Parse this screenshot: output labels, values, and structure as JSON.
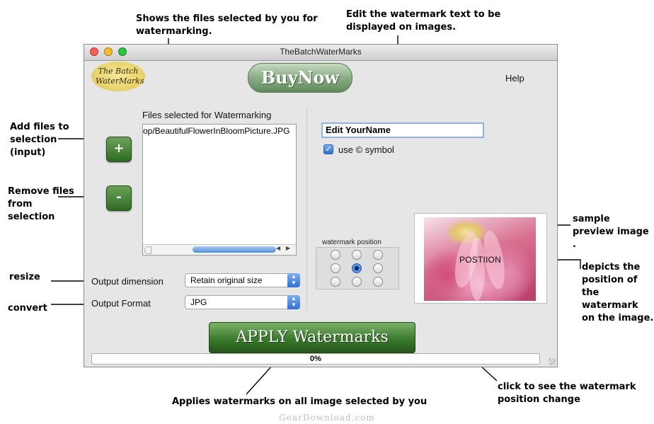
{
  "callouts": {
    "files_selected": "Shows the files selected by you for watermarking.",
    "edit_text": "Edit the watermark text to be displayed on images.",
    "add_files": "Add files to selection (input)",
    "remove_files": "Remove files from selection",
    "resize": "resize",
    "convert": "convert",
    "sample_preview": "sample preview image .",
    "depicts_position": "depicts the position of the watermark on the image.",
    "click_to_see": "click to see the watermark position change",
    "applies_watermarks": "Applies watermarks on all image selected by you"
  },
  "window": {
    "title": "TheBatchWaterMarks",
    "traffic_colors": [
      "#ff5f57",
      "#febc2e",
      "#28c840"
    ]
  },
  "header": {
    "logo_text": "The Batch WaterMarks",
    "buy_now_label": "BuyNow",
    "help_label": "Help"
  },
  "files": {
    "heading": "Files selected for Watermarking",
    "items": [
      "op/BeautifulFlowerInBloomPicture.JPG"
    ],
    "add_label": "+",
    "remove_label": "-"
  },
  "output": {
    "dimension_label": "Output dimension",
    "dimension_value": "Retain original size",
    "format_label": "Output Format",
    "format_value": "JPG"
  },
  "watermark": {
    "text_value": "Edit YourName",
    "use_symbol_label": "use © symbol",
    "use_symbol_checked": true,
    "position_group_label": "watermark position",
    "selected_position": "middle-center",
    "preview_overlay_text": "POSTIION"
  },
  "actions": {
    "apply_label": "APPLY Watermarks",
    "progress_text": "0%",
    "progress_value": 0
  },
  "footer": {
    "site_watermark": "GearDownload.com"
  }
}
